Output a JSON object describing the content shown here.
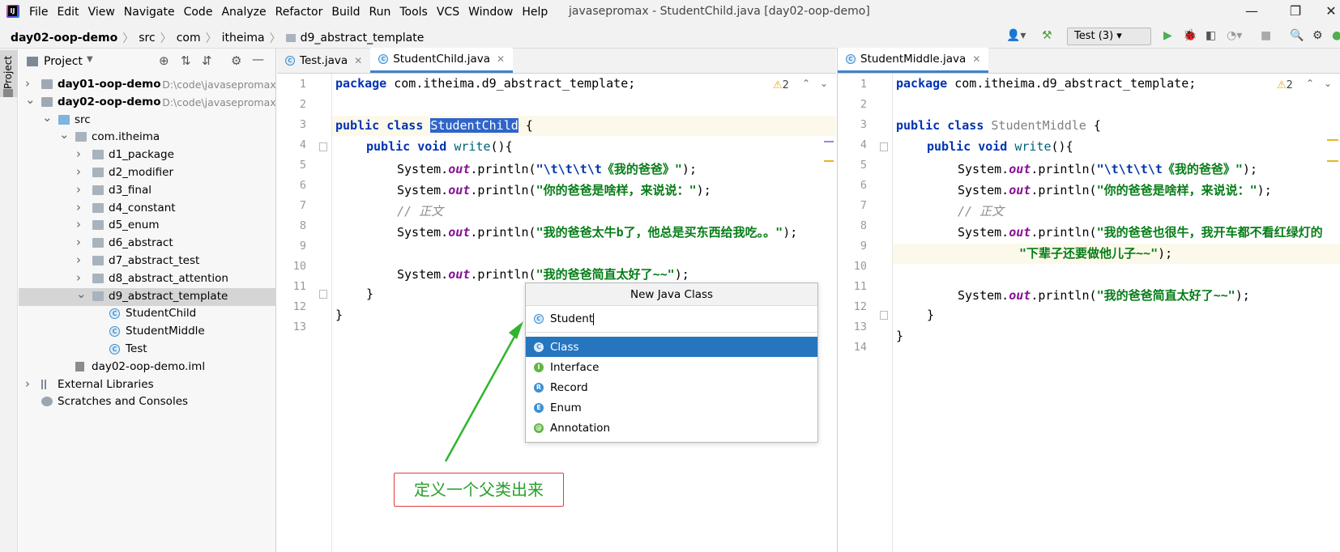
{
  "titlebar": {
    "menu": [
      "File",
      "Edit",
      "View",
      "Navigate",
      "Code",
      "Analyze",
      "Refactor",
      "Build",
      "Run",
      "Tools",
      "VCS",
      "Window",
      "Help"
    ],
    "window_title": "javasepromax - StudentChild.java [day02-oop-demo]"
  },
  "navbar": {
    "breadcrumbs": [
      "day02-oop-demo",
      "src",
      "com",
      "itheima",
      "d9_abstract_template"
    ],
    "run_config": "Test (3)"
  },
  "stripe": {
    "project_tab": "Project"
  },
  "project": {
    "header": "Project",
    "tree": [
      {
        "label": "day01-oop-demo",
        "path": "D:\\code\\javasepromax\\",
        "level": 0,
        "arrow": "▶",
        "icon": "module"
      },
      {
        "label": "day02-oop-demo",
        "path": "D:\\code\\javasepromax\\",
        "level": 0,
        "arrow": "▼",
        "icon": "module"
      },
      {
        "label": "src",
        "level": 1,
        "arrow": "▼",
        "icon": "folder-blue"
      },
      {
        "label": "com.itheima",
        "level": 2,
        "arrow": "▼",
        "icon": "folder"
      },
      {
        "label": "d1_package",
        "level": 3,
        "arrow": "▶",
        "icon": "folder"
      },
      {
        "label": "d2_modifier",
        "level": 3,
        "arrow": "▶",
        "icon": "folder"
      },
      {
        "label": "d3_final",
        "level": 3,
        "arrow": "▶",
        "icon": "folder"
      },
      {
        "label": "d4_constant",
        "level": 3,
        "arrow": "▶",
        "icon": "folder"
      },
      {
        "label": "d5_enum",
        "level": 3,
        "arrow": "▶",
        "icon": "folder"
      },
      {
        "label": "d6_abstract",
        "level": 3,
        "arrow": "▶",
        "icon": "folder"
      },
      {
        "label": "d7_abstract_test",
        "level": 3,
        "arrow": "▶",
        "icon": "folder"
      },
      {
        "label": "d8_abstract_attention",
        "level": 3,
        "arrow": "▶",
        "icon": "folder"
      },
      {
        "label": "d9_abstract_template",
        "level": 3,
        "arrow": "▼",
        "icon": "folder",
        "selected": true
      },
      {
        "label": "StudentChild",
        "level": 4,
        "arrow": "",
        "icon": "class"
      },
      {
        "label": "StudentMiddle",
        "level": 4,
        "arrow": "",
        "icon": "class"
      },
      {
        "label": "Test",
        "level": 4,
        "arrow": "",
        "icon": "class"
      },
      {
        "label": "day02-oop-demo.iml",
        "level": 2,
        "arrow": "",
        "icon": "file"
      },
      {
        "label": "External Libraries",
        "level": 0,
        "arrow": "▶",
        "icon": "lib"
      },
      {
        "label": "Scratches and Consoles",
        "level": 0,
        "arrow": "",
        "icon": "scratch"
      }
    ]
  },
  "left_editor": {
    "tabs": [
      {
        "label": "Test.java",
        "active": false
      },
      {
        "label": "StudentChild.java",
        "active": true
      }
    ],
    "warnings": "2",
    "line_numbers": [
      "1",
      "2",
      "3",
      "4",
      "5",
      "6",
      "7",
      "8",
      "9",
      "10",
      "11",
      "12",
      "13"
    ],
    "lines": {
      "l1_kw": "package",
      "l1_rest": " com.itheima.d9_abstract_template;",
      "l3_kw": "public class",
      "l3_name": "StudentChild",
      "l3_rest": " {",
      "l4_kw": "public void",
      "l4_fn": "write",
      "l4_rest": "(){",
      "sys": "System.",
      "out": "out",
      "println": ".println(",
      "l5_esc": "\"\\t\\t\\t\\t",
      "l5_str": "《我的爸爸》\"",
      "end": ");",
      "l6_str": "\"你的爸爸是啥样，来说说：\"",
      "l7_cmt": "// 正文",
      "l8_str": "\"我的爸爸太牛b了，他总是买东西给我吃。。\"",
      "l10_str": "\"我的爸爸简直太好了~~\"",
      "l11": "}",
      "l12": "}"
    }
  },
  "right_editor": {
    "tabs": [
      {
        "label": "StudentMiddle.java",
        "active": true
      }
    ],
    "warnings": "2",
    "line_numbers": [
      "1",
      "2",
      "3",
      "4",
      "5",
      "6",
      "7",
      "8",
      "9",
      "10",
      "11",
      "12",
      "13",
      "14"
    ],
    "lines": {
      "l1_kw": "package",
      "l1_rest": " com.itheima.d9_abstract_template;",
      "l3_kw": "public class",
      "l3_name": "StudentMiddle",
      "l3_rest": " {",
      "l4_kw": "public void",
      "l4_fn": "write",
      "l4_rest": "(){",
      "sys": "System.",
      "out": "out",
      "println": ".println(",
      "l5_esc": "\"\\t\\t\\t\\t",
      "l5_str": "《我的爸爸》\"",
      "end": ");",
      "l6_str": "\"你的爸爸是啥样，来说说：\"",
      "l7_cmt": "// 正文",
      "l8_str": "\"我的爸爸也很牛，我开车都不看红绿灯的",
      "l9_str": "\"下辈子还要做他儿子~~\"",
      "l11_str": "\"我的爸爸简直太好了~~\"",
      "l12": "}",
      "l13": "}"
    }
  },
  "popup": {
    "title": "New Java Class",
    "input_value": "Student",
    "items": [
      {
        "label": "Class",
        "badge": "C",
        "color": "#3d8fd1",
        "selected": true
      },
      {
        "label": "Interface",
        "badge": "I",
        "color": "#62b543"
      },
      {
        "label": "Record",
        "badge": "R",
        "color": "#3d8fd1"
      },
      {
        "label": "Enum",
        "badge": "E",
        "color": "#3d8fd1"
      },
      {
        "label": "Annotation",
        "badge": "@",
        "color": "#62b543"
      }
    ]
  },
  "annotation": {
    "text": "定义一个父类出来"
  }
}
